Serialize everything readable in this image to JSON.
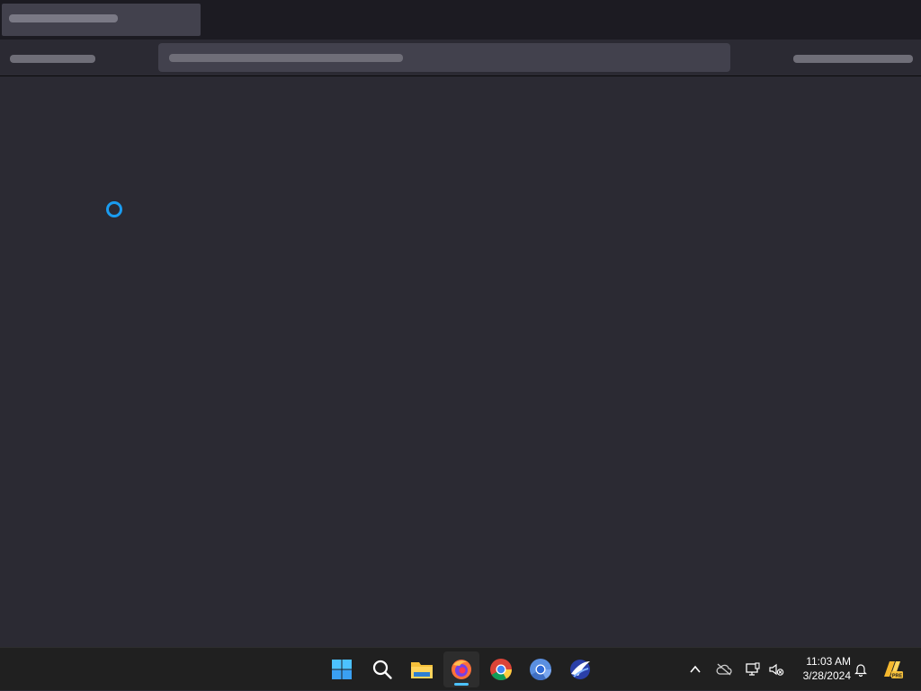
{
  "taskbar": {
    "apps": [
      {
        "name": "start",
        "icon": "windows-start-icon"
      },
      {
        "name": "search",
        "icon": "search-icon"
      },
      {
        "name": "file-explorer",
        "icon": "folder-icon"
      },
      {
        "name": "firefox",
        "icon": "firefox-icon",
        "active": true
      },
      {
        "name": "chrome",
        "icon": "chrome-icon"
      },
      {
        "name": "chromium",
        "icon": "chromium-icon"
      },
      {
        "name": "app",
        "icon": "app-icon"
      }
    ],
    "tray": {
      "time": "11:03 AM",
      "date": "3/28/2024"
    }
  },
  "colors": {
    "page_bg": "#2b2a33",
    "titlebar_bg": "#1c1b22",
    "spinner": "#1a9cf0",
    "taskbar_bg": "#202020",
    "accent_indicator": "#4cc2ff"
  }
}
